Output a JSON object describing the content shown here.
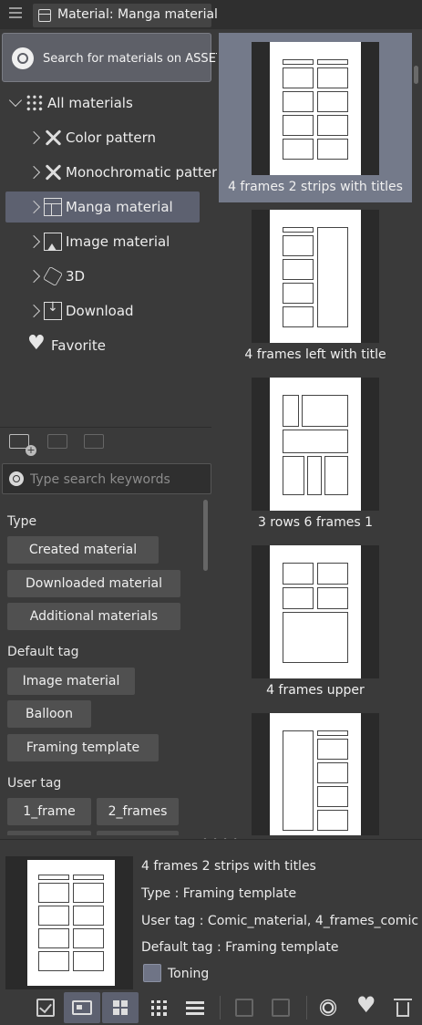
{
  "title": {
    "tab_label": "Material: Manga material"
  },
  "assets_button": {
    "label": "Search for materials on ASSETS"
  },
  "tree": {
    "root": "All materials",
    "items": [
      {
        "label": "Color pattern",
        "icon": "color-pattern-icon"
      },
      {
        "label": "Monochromatic patter",
        "icon": "monochromatic-pattern-icon"
      },
      {
        "label": "Manga material",
        "icon": "manga-material-icon",
        "selected": true
      },
      {
        "label": "Image material",
        "icon": "image-material-icon"
      },
      {
        "label": "3D",
        "icon": "3d-cube-icon"
      },
      {
        "label": "Download",
        "icon": "download-icon"
      }
    ],
    "favorite": "Favorite"
  },
  "search": {
    "placeholder": "Type search keywords"
  },
  "tags": {
    "type_heading": "Type",
    "type": [
      "Created material",
      "Downloaded material",
      "Additional materials"
    ],
    "default_heading": "Default tag",
    "default": [
      "Image material",
      "Balloon",
      "Framing template"
    ],
    "user_heading": "User tag",
    "user": [
      "1_frame",
      "2_frames"
    ]
  },
  "materials": [
    {
      "label": "4 frames 2 strips with titles",
      "selected": true
    },
    {
      "label": "4 frames left with title"
    },
    {
      "label": "3 rows 6 frames 1"
    },
    {
      "label": "4 frames upper"
    },
    {
      "label": ""
    }
  ],
  "details": {
    "name": "4 frames 2 strips with titles",
    "type": "Type : Framing template",
    "user_tag": "User tag : Comic_material, 4_frames_comic",
    "default_tag": "Default tag : Framing template",
    "toning": "Toning",
    "accent": "#5d6170"
  }
}
